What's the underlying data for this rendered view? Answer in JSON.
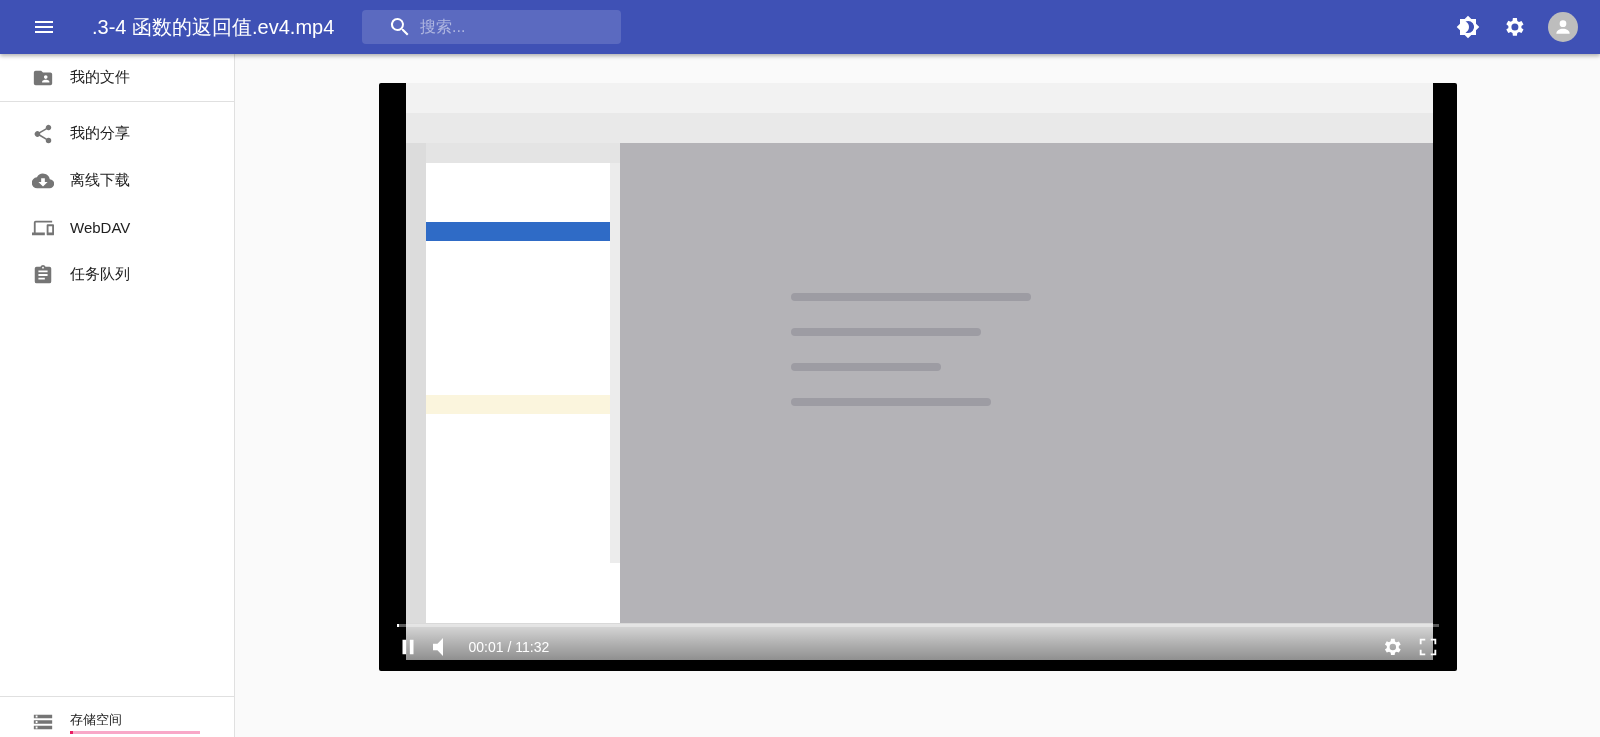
{
  "app_bar": {
    "title": ".3-4 函数的返回值.ev4.mp4",
    "search": {
      "placeholder": "搜索..."
    }
  },
  "sidebar": {
    "items": [
      {
        "kind": "folder",
        "label": "我的文件"
      },
      {
        "kind": "divider"
      },
      {
        "kind": "share",
        "label": "我的分享"
      },
      {
        "kind": "download",
        "label": "离线下载"
      },
      {
        "kind": "devices",
        "label": "WebDAV"
      },
      {
        "kind": "tasks",
        "label": "任务队列"
      }
    ],
    "storage": {
      "label": "存储空间",
      "level": 0.02
    }
  },
  "player": {
    "playing": true,
    "level": 0.002,
    "time": "00:01 / 11:32"
  }
}
